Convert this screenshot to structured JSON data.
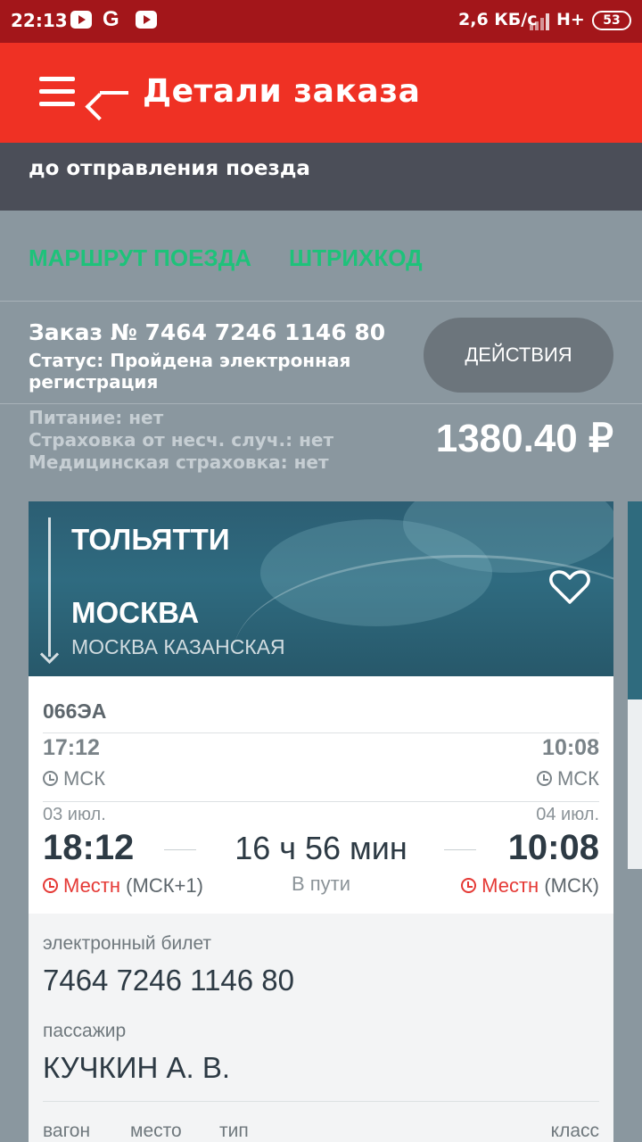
{
  "status_bar": {
    "time": "22:13",
    "google_glyph": "G",
    "speed": "2,6 КБ/с",
    "network": "H+",
    "battery": "53"
  },
  "app_bar": {
    "title": "Детали заказа",
    "menu_icon": "hamburger-menu-icon",
    "back_icon": "arrow-left-icon"
  },
  "banner": {
    "text": "до отправления поезда"
  },
  "links": {
    "route": "МАРШРУТ ПОЕЗДА",
    "barcode": "ШТРИХКОД"
  },
  "order": {
    "number": "Заказ № 7464 7246 1146 80",
    "status": "Статус: Пройдена электронная регистрация",
    "actions_label": "ДЕЙСТВИЯ",
    "meal": "Питание: нет",
    "accident_insurance": "Страховка от несч. случ.: нет",
    "medical_insurance": "Медицинская страховка: нет",
    "price": "1380.40 ₽"
  },
  "trip": {
    "from": "ТОЛЬЯТТИ",
    "to": "МОСКВА",
    "to_station": "МОСКВА КАЗАНСКАЯ",
    "favorite_icon": "heart-outline-icon",
    "train_number": "066ЭА",
    "departure": {
      "msk_time": "17:12",
      "msk_tz": "МСК",
      "date": "03 июл.",
      "local_time": "18:12",
      "local_tz_label": "Местн",
      "local_tz_offset": "(МСК+1)"
    },
    "arrival": {
      "msk_time": "10:08",
      "msk_tz": "МСК",
      "date": "04 июл.",
      "local_time": "10:08",
      "local_tz_label": "Местн",
      "local_tz_offset": "(МСК)"
    },
    "duration": "16 ч 56 мин",
    "duration_label": "В пути"
  },
  "ticket": {
    "type_label": "электронный билет",
    "number": "7464 7246 1146 80",
    "passenger_label": "пассажир",
    "passenger_name": "КУЧКИН А. В.",
    "columns": [
      "вагон",
      "место",
      "тип",
      "класс"
    ]
  },
  "colors": {
    "status_bar": "#a3161a",
    "app_bar": "#ef3124",
    "link_accent": "#1ec27a",
    "local_tz_red": "#e53935"
  }
}
